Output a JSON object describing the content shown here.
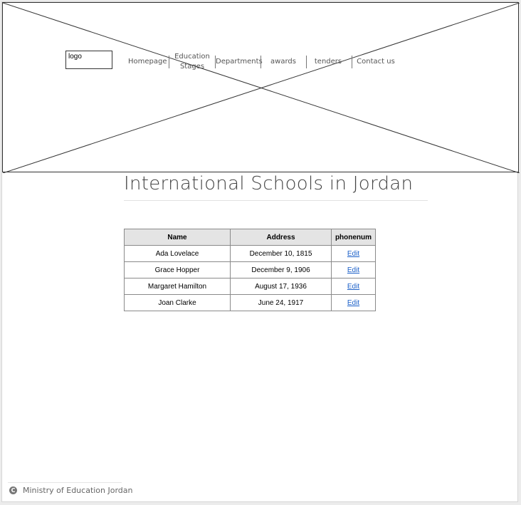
{
  "header": {
    "logo_text": "logo",
    "nav": {
      "homepage": "Homepage",
      "education_line1": "Education",
      "education_line2": "Stages",
      "departments": "Departments",
      "awards": "awards",
      "tenders": "tenders",
      "contact": "Contact us"
    }
  },
  "main": {
    "title": "International Schools in Jordan",
    "table": {
      "headers": [
        "Name",
        "Address",
        "phonenum"
      ],
      "rows": [
        {
          "name": "Ada Lovelace",
          "address": "December 10, 1815",
          "action": "Edit"
        },
        {
          "name": "Grace Hopper",
          "address": "December 9, 1906",
          "action": "Edit"
        },
        {
          "name": "Margaret Hamilton",
          "address": "August 17, 1936",
          "action": "Edit"
        },
        {
          "name": "Joan Clarke",
          "address": "June 24, 1917",
          "action": "Edit"
        }
      ]
    }
  },
  "footer": {
    "icon": "copyright-icon",
    "icon_glyph": "C",
    "text": "Ministry of Education Jordan"
  }
}
